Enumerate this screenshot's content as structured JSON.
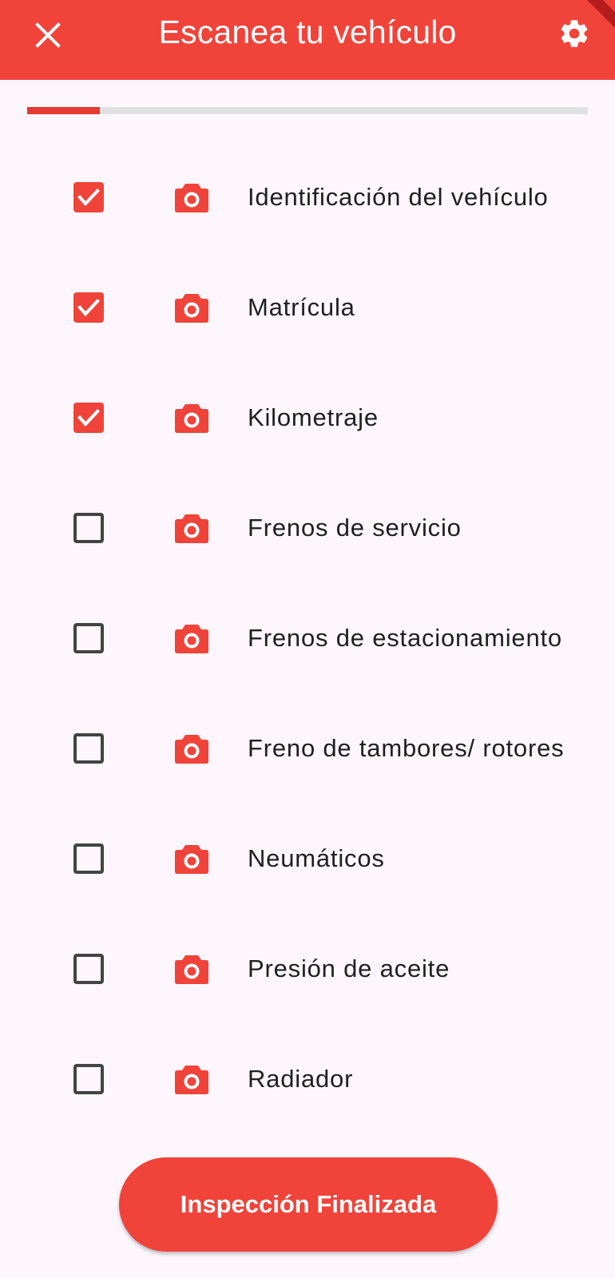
{
  "appbar": {
    "title": "Escanea tu vehículo",
    "close_icon": "close-icon",
    "settings_icon": "gear-icon"
  },
  "progress": {
    "value": 0.13,
    "color": "#e53935",
    "track_color": "#e0e0e0"
  },
  "items": [
    {
      "label": "Identificación del vehículo",
      "checked": true
    },
    {
      "label": "Matrícula",
      "checked": true
    },
    {
      "label": "Kilometraje",
      "checked": true
    },
    {
      "label": "Frenos de servicio",
      "checked": false
    },
    {
      "label": "Frenos de estacionamiento",
      "checked": false
    },
    {
      "label": "Freno de tambores/ rotores",
      "checked": false
    },
    {
      "label": "Neumáticos",
      "checked": false
    },
    {
      "label": "Presión de aceite",
      "checked": false
    },
    {
      "label": "Radiador",
      "checked": false
    }
  ],
  "finish_button": {
    "label": "Inspección Finalizada"
  },
  "colors": {
    "accent": "#f0433a",
    "background": "#fdf7fd",
    "text": "#1f1f1f"
  }
}
